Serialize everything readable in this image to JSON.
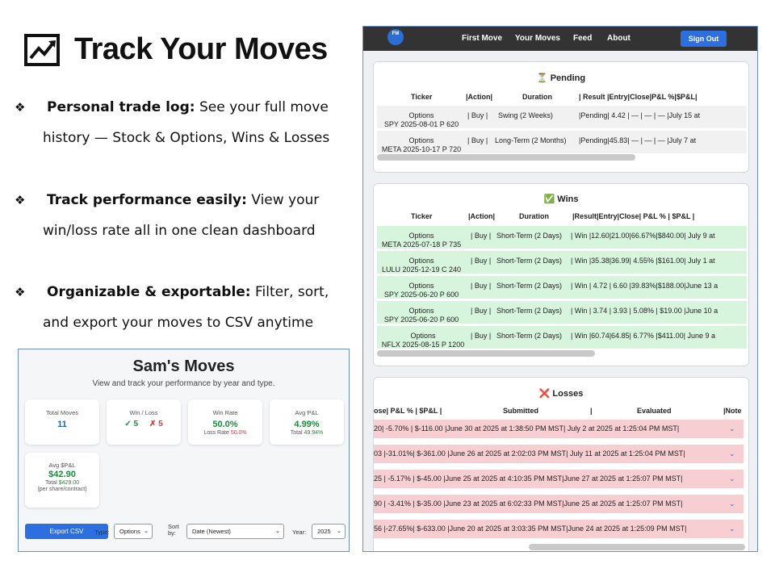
{
  "slide": {
    "title": "Track Your Moves",
    "bullets": [
      {
        "bold": "Personal trade log:",
        "line1_rest": " See your full move",
        "line2": "history — Stock & Options, Wins & Losses"
      },
      {
        "bold": "Track performance easily:",
        "line1_rest": " View your",
        "line2": "win/loss rate all in one clean dashboard"
      },
      {
        "bold": "Organizable  & exportable:",
        "line1_rest": " Filter, sort,",
        "line2": "and export your moves to CSV anytime"
      }
    ]
  },
  "dashboard": {
    "title": "Sam's Moves",
    "subtitle": "View and track your performance by year and type.",
    "cards": {
      "total_moves": {
        "label": "Total Moves",
        "value": "11"
      },
      "win_loss": {
        "label": "Win / Loss",
        "wins": "✓ 5",
        "losses": "✗ 5"
      },
      "win_rate": {
        "label": "Win Rate",
        "value": "50.0%",
        "loss_label": "Loss Rate",
        "loss_value": "50.0%"
      },
      "avg_pnl": {
        "label": "Avg P&L",
        "value": "4.99%",
        "total_label": "Total",
        "total_value": "49.94%"
      },
      "avg_dollar_pnl": {
        "label": "Avg $P&L",
        "value": "$42.90",
        "total_label": "Total",
        "total_value": "$429.00",
        "note": "(per share/contract)"
      }
    },
    "controls": {
      "export_label": "Export CSV",
      "type_label": "Type:",
      "type_value": "Options",
      "sort_label_1": "Sort",
      "sort_label_2": "by:",
      "sort_value": "Date (Newest)",
      "year_label": "Year:",
      "year_value": "2025"
    }
  },
  "app": {
    "logo": "FM",
    "nav": [
      "First Move",
      "Your Moves",
      "Feed",
      "About"
    ],
    "signout": "Sign Out",
    "pending": {
      "title": "Pending",
      "icon": "⏳",
      "headers": {
        "ticker": "Ticker",
        "action": "|Action|",
        "duration": "Duration",
        "rest": "| Result |Entry|Close|P&L %|$P&L|"
      },
      "rows": [
        {
          "type": "Options",
          "ticker": "SPY 2025-08-01 P 620",
          "action": "|  Buy  |",
          "duration": "Swing (2 Weeks)",
          "rest": "|Pending| 4.42  |  —  |  —  |  —  |July 15 at"
        },
        {
          "type": "Options",
          "ticker": "META 2025-10-17 P 720",
          "action": "|  Buy  |",
          "duration": "Long-Term (2 Months)",
          "rest": "|Pending|45.83|  —  |  —  |  —  |July 7 at"
        }
      ]
    },
    "wins": {
      "title": "Wins",
      "icon": "✅",
      "headers": {
        "ticker": "Ticker",
        "action": "|Action|",
        "duration": "Duration",
        "rest": "|Result|Entry|Close| P&L % |  $P&L  |"
      },
      "rows": [
        {
          "type": "Options",
          "ticker": "META 2025-07-18 P 735",
          "action": "|  Buy  |",
          "duration": "Short-Term (2 Days)",
          "rest": "|  Win  |12.60|21.00|66.67%|$840.00| July 9 at"
        },
        {
          "type": "Options",
          "ticker": "LULU 2025-12-19 C 240",
          "action": "|  Buy  |",
          "duration": "Short-Term (2 Days)",
          "rest": "|  Win  |35.38|36.99| 4.55% |$161.00| July 1 at"
        },
        {
          "type": "Options",
          "ticker": "SPY 2025-06-20 P 600",
          "action": "|  Buy  |",
          "duration": "Short-Term (2 Days)",
          "rest": "|  Win  | 4.72 | 6.60 |39.83%|$188.00|June 13 a"
        },
        {
          "type": "Options",
          "ticker": "SPY 2025-06-20 P 600",
          "action": "|  Buy  |",
          "duration": "Short-Term (2 Days)",
          "rest": "|  Win  | 3.74 | 3.93 | 5.08% | $19.00 |June 10 a"
        },
        {
          "type": "Options",
          "ticker": "NFLX 2025-08-15 P 1200",
          "action": "|  Buy  |",
          "duration": "Short-Term (2 Days)",
          "rest": "|  Win  |60.74|64.85| 6.77% |$411.00| June 9 a"
        }
      ]
    },
    "losses": {
      "title": "Losses",
      "icon": "❌",
      "headers": {
        "left": "ose|  P&L %  |   $P&L  |",
        "submitted": "Submitted",
        "sep": "|",
        "evaluated": "Evaluated",
        "note": "|Note"
      },
      "rows": [
        {
          "left": "20| -5.70% | $-116.00 |June 30 at 2025 at 1:38:50 PM MST| July 2 at 2025 at 1:25:04 PM MST|"
        },
        {
          "left": "03 |-31.01%| $-361.00 |June 26 at 2025 at 2:02:03 PM MST| July 11 at 2025 at 1:25:04 PM MST|"
        },
        {
          "left": "25 | -5.17% | $-45.00 |June 25 at 2025 at 4:10:35 PM MST|June 27 at 2025 at 1:25:07 PM MST|"
        },
        {
          "left": "90 | -3.41% | $-35.00 |June 23 at 2025 at 6:02:33 PM MST|June 25 at 2025 at 1:25:07 PM MST|"
        },
        {
          "left": "56 |-27.65%| $-633.00 |June 20 at 2025 at 3:03:35 PM MST|June 24 at 2025 at 1:25:09 PM MST|"
        }
      ]
    }
  }
}
